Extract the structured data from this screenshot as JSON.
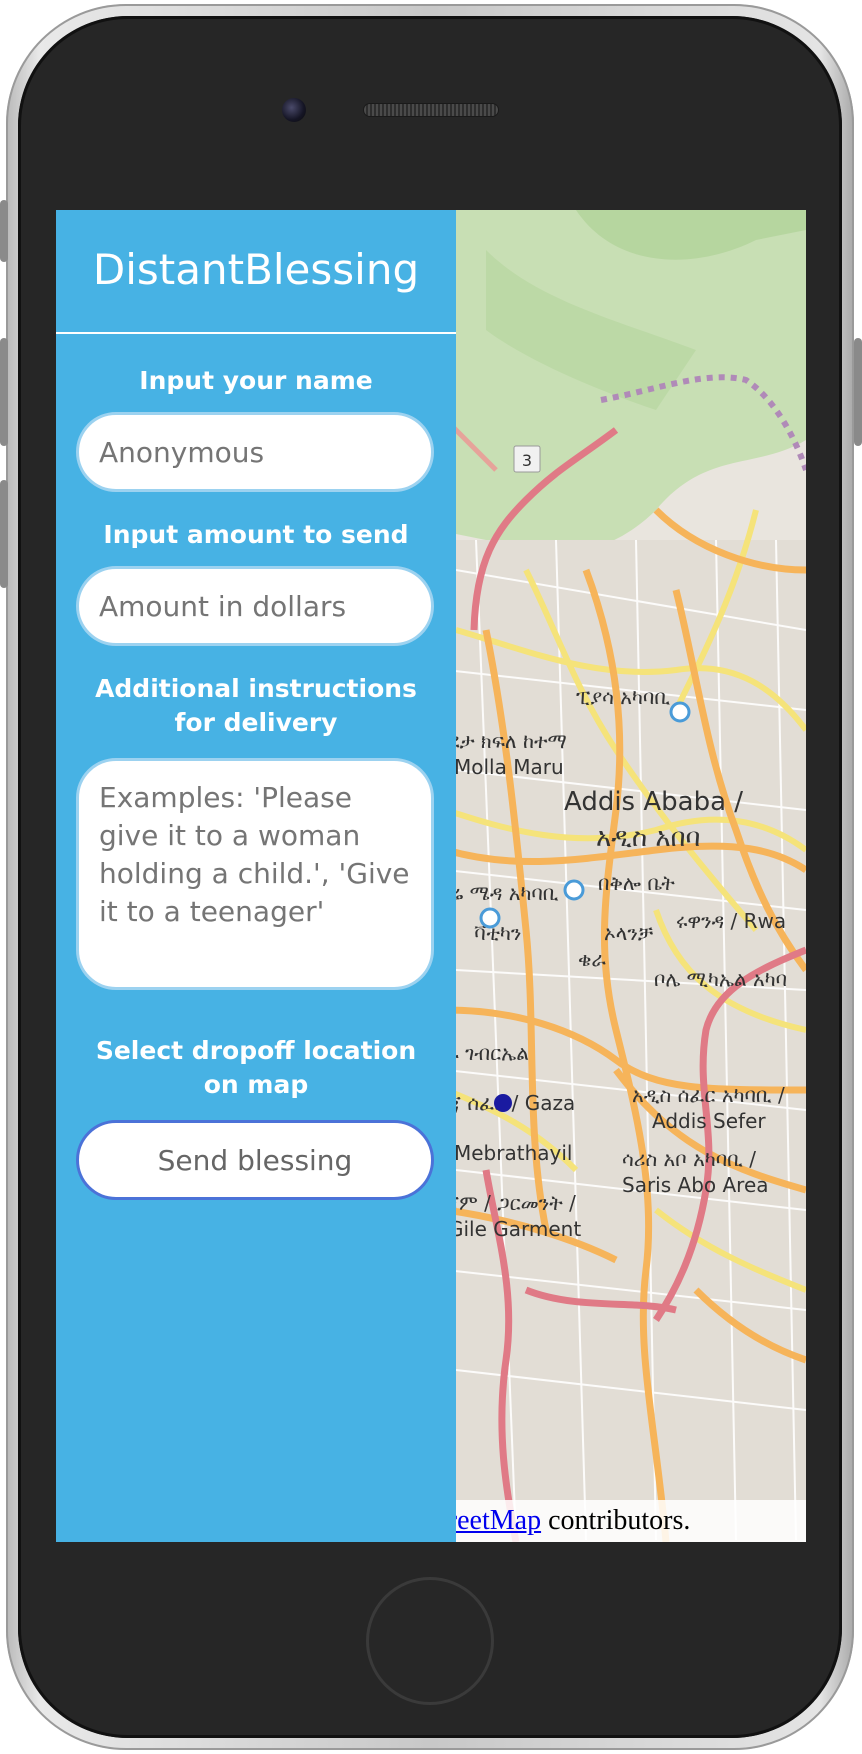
{
  "app": {
    "title": "DistantBlessing"
  },
  "form": {
    "name_label": "Input your name",
    "name_placeholder": "Anonymous",
    "amount_label": "Input amount to send",
    "amount_placeholder": "Amount in dollars",
    "instructions_label": "Additional instructions for delivery",
    "instructions_placeholder": "Examples: 'Please give it to a woman holding a child.', 'Give it to a teenager'",
    "location_label": "Select dropoff location on map",
    "send_button": "Send blessing"
  },
  "map": {
    "city_name": "Addis Ababa /",
    "city_name_amharic": "አዲስ አበባ",
    "road_shield": "3",
    "places": [
      "ፒያሳ አካባቢ",
      "ልደታ ክፍለ ከተማ",
      "Molla Maru",
      "ቸሬ ሜዳ አካባቢ",
      "በቅሎ ቤት",
      "ቫቲካን",
      "ኦላንቻ",
      "ሩዋንዳ / Rwa",
      "ቄራ",
      "ቦሌ ሚካኤል አካባ",
      "ጎፋ ገብርኤል",
      "ጌጃ ሰፈር / Gaza",
      "አዲስ ሰፈር አካባቢ /",
      "Addis Sefer",
      "ሳሪስ አቦ አካባቢ /",
      "Saris Abo Area",
      "Mebrathayil",
      "ጎጃም / ጋርመንት /",
      "Gile Garment"
    ],
    "attribution_link": "OpenStreetMap",
    "attribution_text": " contributors.",
    "attribution_link_visible": "enStreetMap",
    "colors": {
      "sidebar": "#47b2e4",
      "button_border": "#4b72d8",
      "marker": "#1a1aa0"
    }
  }
}
